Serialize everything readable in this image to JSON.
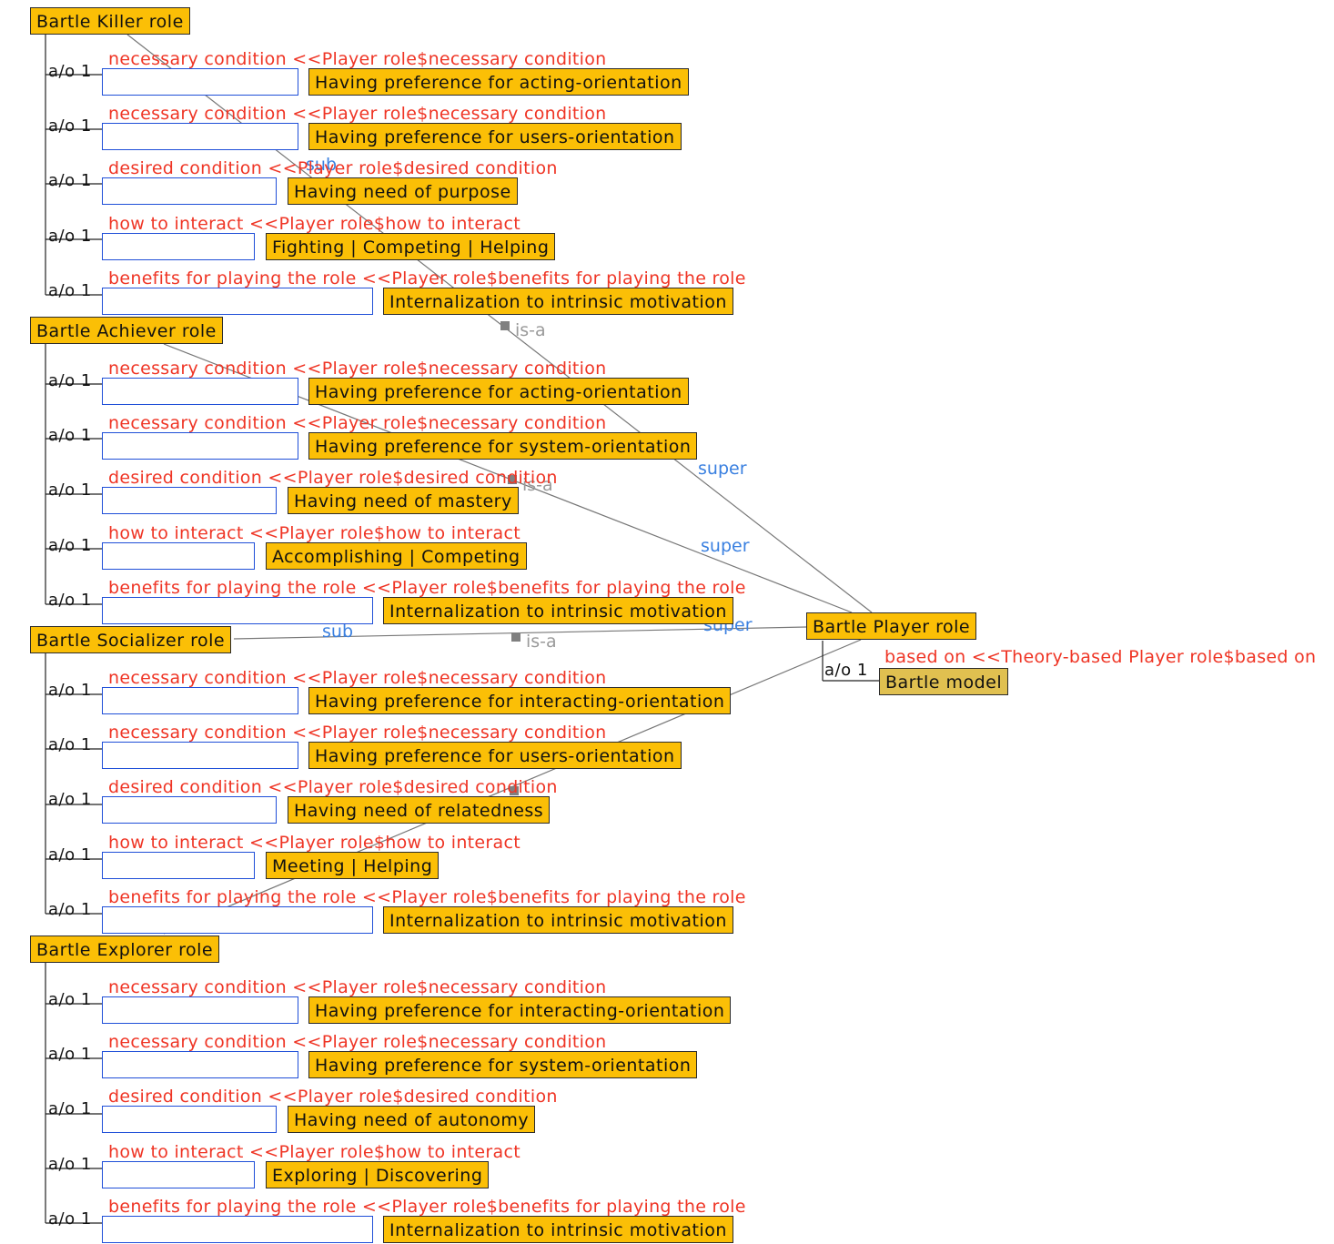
{
  "cardinality": "a/o 1",
  "parent": {
    "label": "Bartle Player role",
    "slot_label": "based on <<Theory-based Player role$based on",
    "slot_value": "Bartle model"
  },
  "roles": [
    {
      "label": "Bartle Killer role",
      "slots": [
        {
          "label": "necessary condition <<Player role$necessary condition",
          "value": "Having preference for acting-orientation"
        },
        {
          "label": "necessary condition <<Player role$necessary condition",
          "value": "Having preference for users-orientation"
        },
        {
          "label": "desired condition <<Player role$desired condition",
          "value": "Having need of purpose"
        },
        {
          "label": "how to interact <<Player role$how to interact",
          "value": "Fighting | Competing | Helping"
        },
        {
          "label": "benefits for playing the role <<Player role$benefits for playing the role",
          "value": "Internalization to intrinsic motivation"
        }
      ]
    },
    {
      "label": "Bartle Achiever role",
      "slots": [
        {
          "label": "necessary condition <<Player role$necessary condition",
          "value": "Having preference for acting-orientation"
        },
        {
          "label": "necessary condition <<Player role$necessary condition",
          "value": "Having preference for system-orientation"
        },
        {
          "label": "desired condition <<Player role$desired condition",
          "value": "Having need of mastery"
        },
        {
          "label": "how to interact <<Player role$how to interact",
          "value": "Accomplishing | Competing"
        },
        {
          "label": "benefits for playing the role <<Player role$benefits for playing the role",
          "value": "Internalization to intrinsic motivation"
        }
      ]
    },
    {
      "label": "Bartle Socializer role",
      "slots": [
        {
          "label": "necessary condition <<Player role$necessary condition",
          "value": "Having preference for interacting-orientation"
        },
        {
          "label": "necessary condition <<Player role$necessary condition",
          "value": "Having preference for users-orientation"
        },
        {
          "label": "desired condition <<Player role$desired condition",
          "value": "Having need of relatedness"
        },
        {
          "label": "how to interact <<Player role$how to interact",
          "value": "Meeting | Helping"
        },
        {
          "label": "benefits for playing the role <<Player role$benefits for playing the role",
          "value": "Internalization to intrinsic motivation"
        }
      ]
    },
    {
      "label": "Bartle Explorer role",
      "slots": [
        {
          "label": "necessary condition <<Player role$necessary condition",
          "value": "Having preference for interacting-orientation"
        },
        {
          "label": "necessary condition <<Player role$necessary condition",
          "value": "Having preference for system-orientation"
        },
        {
          "label": "desired condition <<Player role$desired condition",
          "value": "Having need of autonomy"
        },
        {
          "label": "how to interact <<Player role$how to interact",
          "value": "Exploring | Discovering"
        },
        {
          "label": "benefits for playing the role <<Player role$benefits for playing the role",
          "value": "Internalization to intrinsic motivation"
        }
      ]
    }
  ],
  "edges": {
    "sub": "sub",
    "super": "super",
    "isa": "is-a"
  }
}
